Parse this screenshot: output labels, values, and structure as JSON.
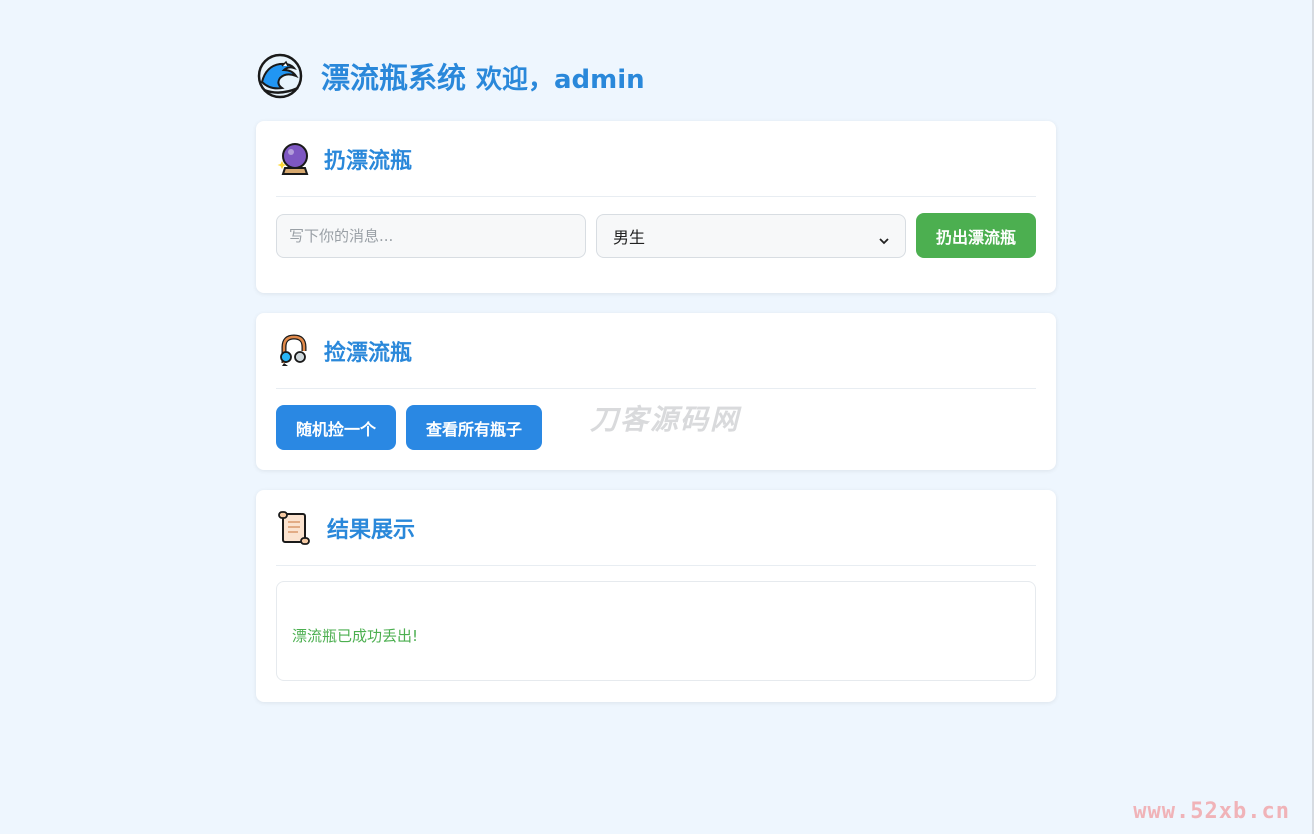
{
  "header": {
    "title": "漂流瓶系统",
    "welcome": "欢迎，admin",
    "icon": "water-wave-icon"
  },
  "throw_card": {
    "title": "扔漂流瓶",
    "icon": "crystal-ball-icon",
    "message_placeholder": "写下你的消息...",
    "message_value": "",
    "gender_selected": "男生",
    "throw_button": "扔出漂流瓶"
  },
  "pick_card": {
    "title": "捡漂流瓶",
    "icon": "fishing-hook-icon",
    "random_button": "随机捡一个",
    "view_all_button": "查看所有瓶子",
    "watermark": "刀客源码网"
  },
  "result_card": {
    "title": "结果展示",
    "icon": "scroll-icon",
    "message": "漂流瓶已成功丢出!"
  },
  "site_watermark": "www.52xb.cn",
  "colors": {
    "background": "#eef6fe",
    "accent": "#2a88da",
    "success": "#4caf50",
    "button_blue": "#2a88e3"
  }
}
